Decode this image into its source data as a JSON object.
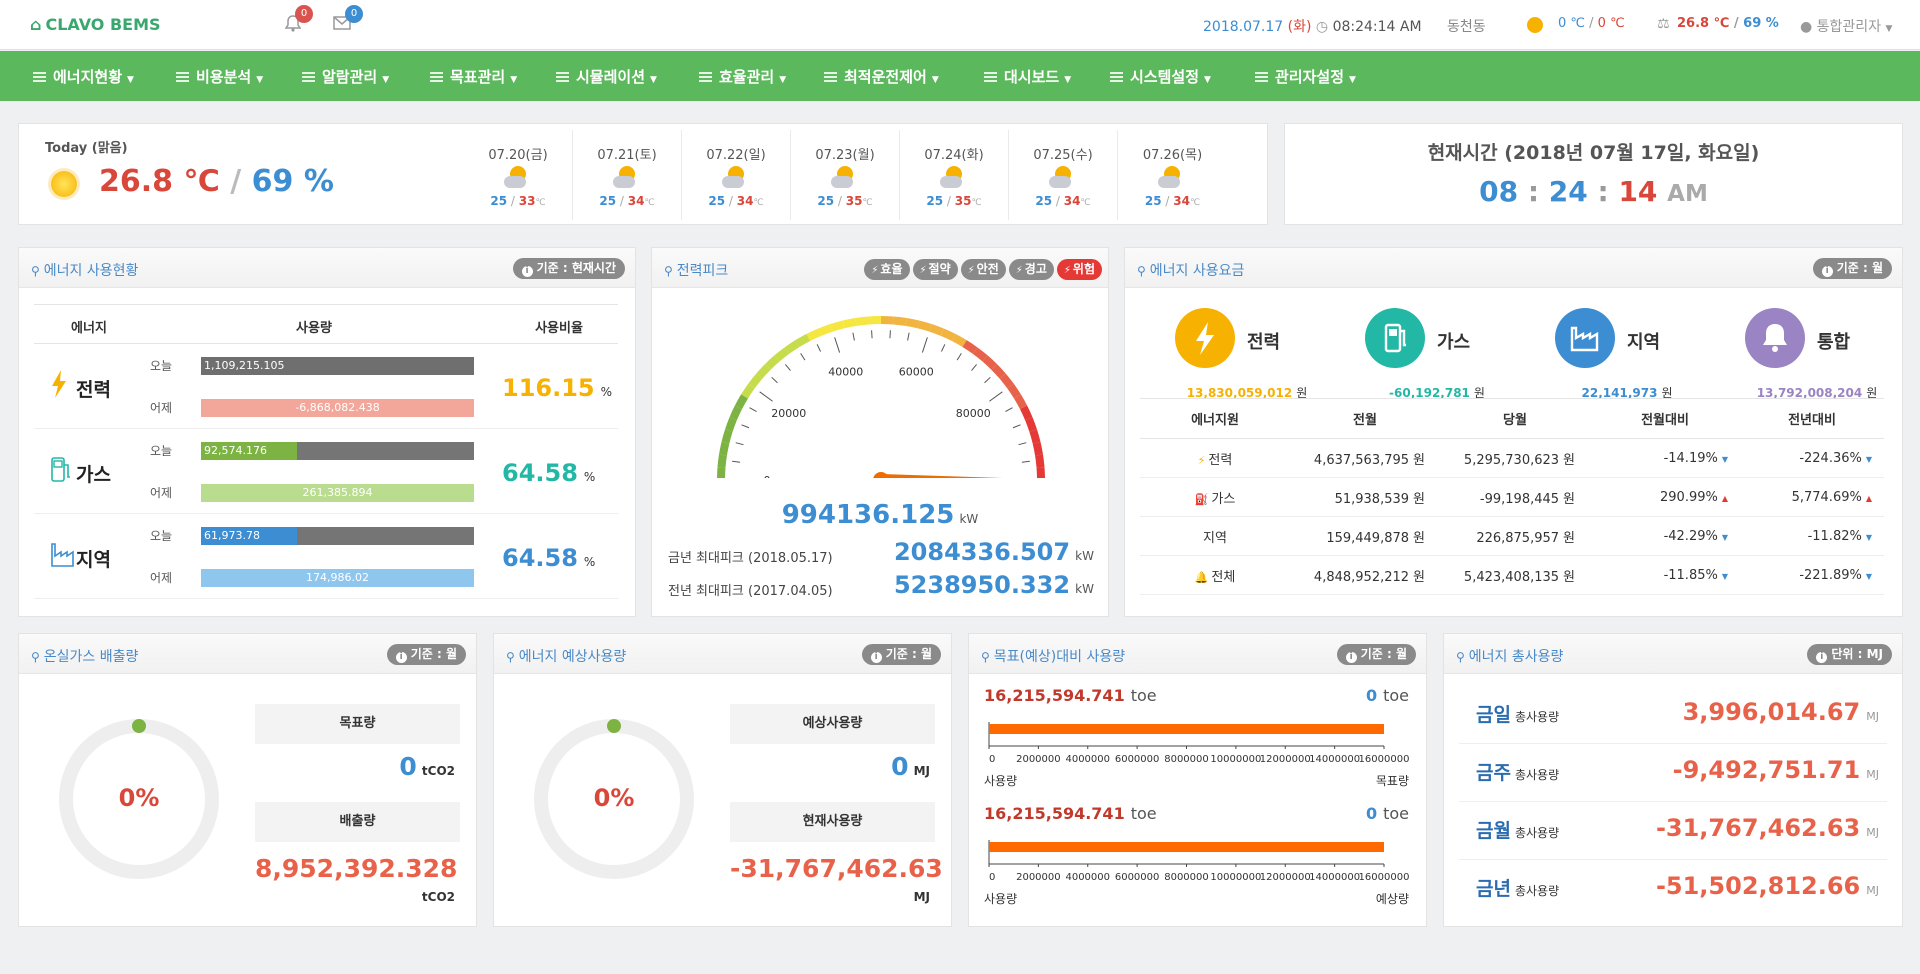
{
  "topbar": {
    "brand": "CLAVO BEMS",
    "alarm_count": "0",
    "mail_count": "0",
    "date": "2018.07.17",
    "weekday": "(화)",
    "time": "08:24:14 AM",
    "district": "동천동",
    "outdoor_temp": "0 ℃",
    "outdoor_sep": " / ",
    "outdoor_temp2": "0 ℃",
    "indoor_temp": "26.8 ℃",
    "indoor_sep": " / ",
    "indoor_humidity": "69 %",
    "user": "통합관리자"
  },
  "menu": [
    "에너지현황",
    "비용분석",
    "알람관리",
    "목표관리",
    "시뮬레이션",
    "효율관리",
    "최적운전제어",
    "대시보드",
    "시스템설정",
    "관리자설정"
  ],
  "weather": {
    "today_label": "Today (맑음)",
    "today_temp": "26.8 ℃",
    "today_sep": " / ",
    "today_humidity": "69 %",
    "forecast": [
      {
        "date": "07.20(금)",
        "low": "25",
        "high": "33"
      },
      {
        "date": "07.21(토)",
        "low": "25",
        "high": "34"
      },
      {
        "date": "07.22(일)",
        "low": "25",
        "high": "34"
      },
      {
        "date": "07.23(월)",
        "low": "25",
        "high": "35"
      },
      {
        "date": "07.24(화)",
        "low": "25",
        "high": "35"
      },
      {
        "date": "07.25(수)",
        "low": "25",
        "high": "34"
      },
      {
        "date": "07.26(목)",
        "low": "25",
        "high": "34"
      }
    ],
    "unit": "℃",
    "sep": " / "
  },
  "clock": {
    "title": "현재시간 (2018년 07월 17일, 화요일)",
    "hh": "08",
    "mm": "24",
    "ss": "14",
    "ampm": "AM",
    "colon": ":"
  },
  "usage": {
    "title": "에너지 사용현황",
    "badge": "기준 : 현재시간",
    "col_energy": "에너지",
    "col_amount": "사용량",
    "col_ratio": "사용비율",
    "today": "오늘",
    "yesterday": "어제",
    "rows": [
      {
        "name": "전력",
        "today": "1,109,215.105",
        "yesterday": "-6,868,082.438",
        "ratio": "116.15",
        "today_frac": 1.0,
        "yest_frac": 1.0
      },
      {
        "name": "가스",
        "today": "92,574.176",
        "yesterday": "261,385.894",
        "ratio": "64.58",
        "today_frac": 0.35,
        "yest_frac": 1.0
      },
      {
        "name": "지역",
        "today": "61,973.78",
        "yesterday": "174,986.02",
        "ratio": "64.58",
        "today_frac": 0.35,
        "yest_frac": 1.0
      }
    ],
    "pct": "%"
  },
  "peak": {
    "title": "전력피크",
    "levels": [
      "효율",
      "절약",
      "안전",
      "경고",
      "위험"
    ],
    "gauge_ticks": [
      "0",
      "20000",
      "40000",
      "60000",
      "80000"
    ],
    "gauge_max": 100000,
    "current": "994136.125",
    "unit": "kW",
    "year_label": "금년 최대피크 (2018.05.17)",
    "year_value": "2084336.507",
    "prev_label": "전년 최대피크 (2017.04.05)",
    "prev_value": "5238950.332"
  },
  "fee": {
    "title": "에너지 사용요금",
    "badge": "기준 : 월",
    "cards": [
      {
        "name": "전력",
        "value": "13,830,059,012",
        "color": "#f7b100"
      },
      {
        "name": "가스",
        "value": "-60,192,781",
        "color": "#23b8a6"
      },
      {
        "name": "지역",
        "value": "22,141,973",
        "color": "#3c8dd1"
      },
      {
        "name": "통합",
        "value": "13,792,008,204",
        "color": "#9a84c4"
      }
    ],
    "won": "원",
    "headers": [
      "에너지원",
      "전월",
      "당월",
      "전월대비",
      "전년대비"
    ],
    "rows": [
      {
        "name": "전력",
        "prev": "4,637,563,795",
        "cur": "5,295,730,623",
        "mom": "-14.19%",
        "yoy": "-224.36%",
        "mom_up": false,
        "yoy_up": false
      },
      {
        "name": "가스",
        "prev": "51,938,539",
        "cur": "-99,198,445",
        "mom": "290.99%",
        "yoy": "5,774.69%",
        "mom_up": true,
        "yoy_up": true
      },
      {
        "name": "지역",
        "prev": "159,449,878",
        "cur": "226,875,957",
        "mom": "-42.29%",
        "yoy": "-11.82%",
        "mom_up": false,
        "yoy_up": false
      },
      {
        "name": "전체",
        "prev": "4,848,952,212",
        "cur": "5,423,408,135",
        "mom": "-11.85%",
        "yoy": "-221.89%",
        "mom_up": false,
        "yoy_up": false
      }
    ]
  },
  "ghg": {
    "title": "온실가스 배출량",
    "badge": "기준 : 월",
    "percent": "0%",
    "target_label": "목표량",
    "target_value": "0",
    "unit": "tCO2",
    "emit_label": "배출량",
    "emit_value": "8,952,392.328"
  },
  "forecast_use": {
    "title": "에너지 예상사용량",
    "badge": "기준 : 월",
    "percent": "0%",
    "expected_label": "예상사용량",
    "expected_value": "0",
    "unit": "MJ",
    "current_label": "현재사용량",
    "current_value": "-31,767,462.63"
  },
  "target_usage": {
    "title": "목표(예상)대비 사용량",
    "badge": "기준 : 월",
    "toe": "toe",
    "charts": [
      {
        "used": "16,215,594.741",
        "target": "0",
        "left_label": "사용량",
        "right_label": "목표량"
      },
      {
        "used": "16,215,594.741",
        "target": "0",
        "left_label": "사용량",
        "right_label": "예상량"
      }
    ],
    "ticks": [
      "0",
      "2000000",
      "4000000",
      "6000000",
      "8000000",
      "10000000",
      "12000000",
      "14000000",
      "16000000"
    ],
    "max": 16000000,
    "bar_value": 16215594.741
  },
  "total_usage": {
    "title": "에너지 총사용량",
    "badge": "단위 : MJ",
    "suffix": "총사용량",
    "unit": "MJ",
    "rows": [
      {
        "label": "금일",
        "value": "3,996,014.67"
      },
      {
        "label": "금주",
        "value": "-9,492,751.71"
      },
      {
        "label": "금월",
        "value": "-31,767,462.63"
      },
      {
        "label": "금년",
        "value": "-51,502,812.66"
      }
    ]
  },
  "colors": {
    "green": "#5cb85c",
    "blue": "#3c8dd1",
    "red": "#d9463a",
    "orange": "#e8624a"
  }
}
